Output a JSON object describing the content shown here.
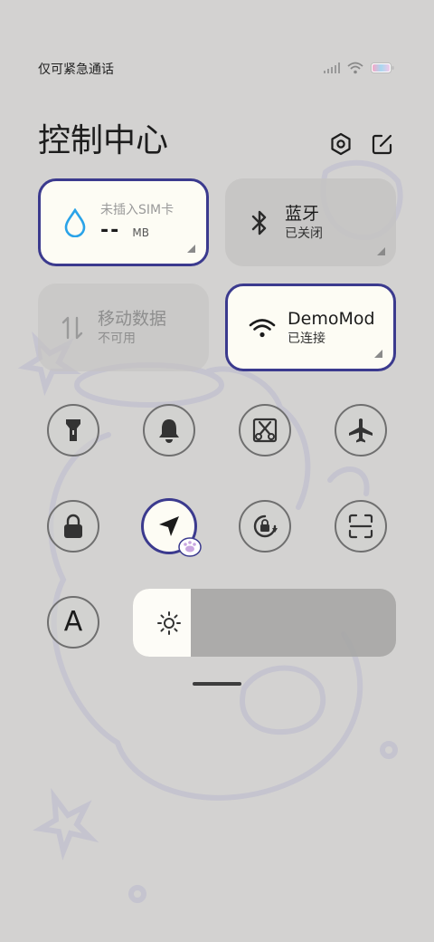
{
  "status_bar": {
    "carrier_text": "仅可紧急通话",
    "icons": [
      "signal-icon",
      "wifi-icon",
      "battery-icon"
    ]
  },
  "header": {
    "title": "控制中心",
    "settings_icon": "gear-icon",
    "edit_icon": "edit-icon"
  },
  "tiles": {
    "data_usage": {
      "title": "未插入SIM卡",
      "value": "--",
      "unit": "MB",
      "active": true
    },
    "bluetooth": {
      "title": "蓝牙",
      "status": "已关闭",
      "active": false
    },
    "mobile_data": {
      "title": "移动数据",
      "status": "不可用",
      "active": false,
      "disabled": true
    },
    "wifi": {
      "title": "DemoMod",
      "status": "已连接",
      "active": true
    }
  },
  "toggles": [
    {
      "name": "flashlight",
      "icon": "flashlight-icon",
      "active": false
    },
    {
      "name": "mute",
      "icon": "bell-icon",
      "active": false
    },
    {
      "name": "screenshot",
      "icon": "scissors-icon",
      "active": false
    },
    {
      "name": "airplane-mode",
      "icon": "airplane-icon",
      "active": false
    },
    {
      "name": "lock-screen",
      "icon": "lock-icon",
      "active": false
    },
    {
      "name": "location",
      "icon": "location-arrow-icon",
      "active": true
    },
    {
      "name": "rotation-lock",
      "icon": "rotation-lock-icon",
      "active": false
    },
    {
      "name": "scan",
      "icon": "scan-icon",
      "active": false
    },
    {
      "name": "font-size",
      "icon": "font-a-icon",
      "label": "A",
      "active": false
    }
  ],
  "brightness": {
    "level": 0.22,
    "icon": "sun-icon"
  },
  "colors": {
    "background": "#d3d2d1",
    "active_tile": "#fdfcf4",
    "active_border": "#3b3a8e",
    "wifi_accent": "#2aa3e8"
  }
}
